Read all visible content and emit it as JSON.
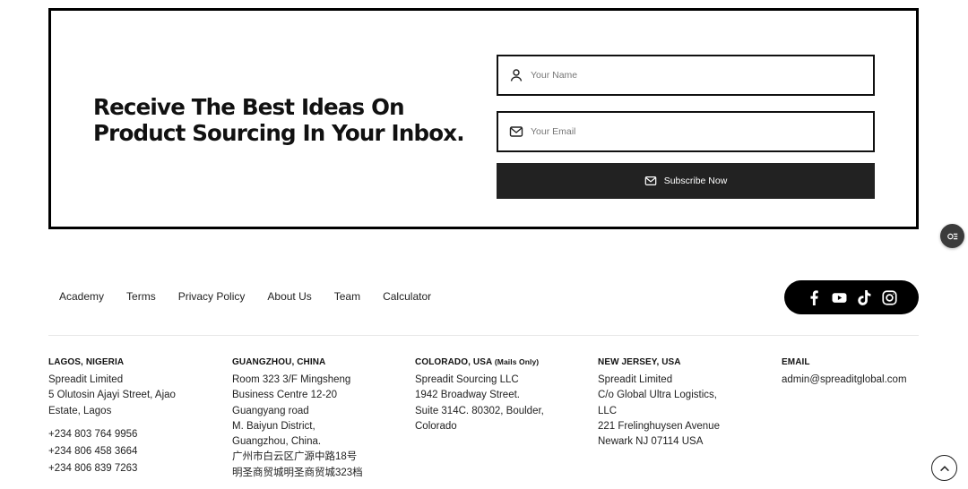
{
  "newsletter": {
    "title": "Receive The Best Ideas On Product Sourcing In Your Inbox.",
    "name_placeholder": "Your Name",
    "email_placeholder": "Your Email",
    "subscribe_label": "Subscribe Now"
  },
  "footer_nav": [
    "Academy",
    "Terms",
    "Privacy Policy",
    "About Us",
    "Team",
    "Calculator"
  ],
  "social_icons": [
    "facebook-icon",
    "youtube-icon",
    "tiktok-icon",
    "instagram-icon"
  ],
  "offices": {
    "lagos": {
      "heading": "LAGOS, NIGERIA",
      "lines": [
        "Spreadit Limited",
        "5 Olutosin Ajayi Street, Ajao",
        "Estate, Lagos"
      ],
      "phones": [
        "+234 803 764 9956",
        "+234 806 458 3664",
        "+234 806 839 7263"
      ]
    },
    "guangzhou": {
      "heading": "GUANGZHOU, CHINA",
      "lines": [
        "Room 323 3/F Mingsheng",
        "Business Centre 12-20",
        "Guangyang road",
        "M. Baiyun District,",
        "Guangzhou, China.",
        "广州市白云区广源中路18号",
        "明圣商贸城明圣商贸城323档"
      ]
    },
    "colorado": {
      "heading": "COLORADO, USA",
      "heading_note": "(Mails Only)",
      "lines": [
        "Spreadit Sourcing LLC",
        "1942 Broadway Street.",
        "Suite 314C. 80302, Boulder,",
        "Colorado"
      ]
    },
    "new_jersey": {
      "heading": "NEW JERSEY, USA",
      "lines": [
        "Spreadit Limited",
        "C/o Global Ultra Logistics,",
        "LLC",
        "221 Frelinghuysen Avenue",
        "Newark NJ 07114 USA"
      ]
    },
    "email": {
      "heading": "EMAIL",
      "lines": [
        "admin@spreaditglobal.com"
      ]
    }
  },
  "colors": {
    "button_bg": "#222222",
    "social_bg": "#000000",
    "border": "#000000"
  }
}
